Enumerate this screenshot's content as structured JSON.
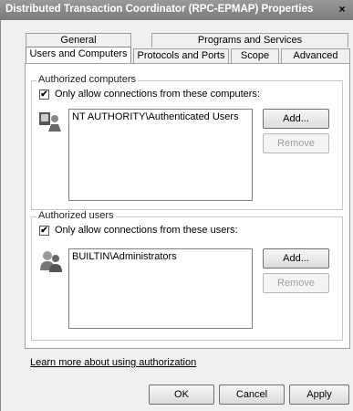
{
  "window": {
    "title": "Distributed Transaction Coordinator (RPC-EPMAP) Properties",
    "close_label": "×"
  },
  "tabs": {
    "back_row": [
      "General",
      "Programs and Services"
    ],
    "front_row": [
      "Users and Computers",
      "Protocols and Ports",
      "Scope",
      "Advanced"
    ]
  },
  "authorized_computers": {
    "legend": "Authorized computers",
    "checkbox_label": "Only allow connections from these computers:",
    "checked": true,
    "items": [
      "NT AUTHORITY\\Authenticated Users"
    ],
    "add_label": "Add...",
    "remove_label": "Remove"
  },
  "authorized_users": {
    "legend": "Authorized users",
    "checkbox_label": "Only allow connections from these users:",
    "checked": true,
    "items": [
      "BUILTIN\\Administrators"
    ],
    "add_label": "Add...",
    "remove_label": "Remove"
  },
  "learn_more_link": "Learn more about using authorization",
  "footer": {
    "ok_label": "OK",
    "cancel_label": "Cancel",
    "apply_label": "Apply"
  },
  "check_mark": "✔"
}
